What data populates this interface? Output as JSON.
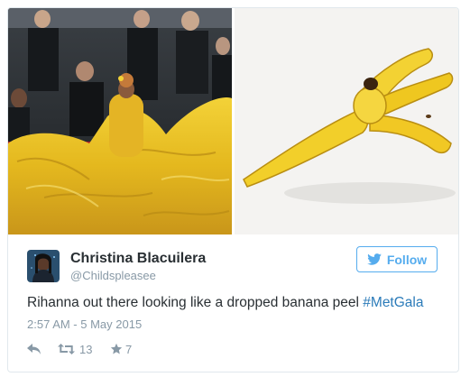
{
  "media": {
    "left_photo": "red-carpet-yellow-gown-photo",
    "right_photo": "banana-peel-photo"
  },
  "user": {
    "name": "Christina Blacuilera",
    "handle": "@Childspleasee"
  },
  "follow_button": {
    "label": "Follow",
    "icon": "twitter-bird-icon",
    "color": "#55acee"
  },
  "tweet": {
    "text": "Rihanna out there looking like a dropped banana peel ",
    "hashtag": "#MetGala",
    "hashtag_color": "#2b7bb9"
  },
  "timestamp": "2:57 AM - 5 May 2015",
  "actions": {
    "reply_icon": "reply-icon",
    "retweet_icon": "retweet-icon",
    "retweet_count": "13",
    "favorite_icon": "star-icon",
    "favorite_count": "7"
  }
}
